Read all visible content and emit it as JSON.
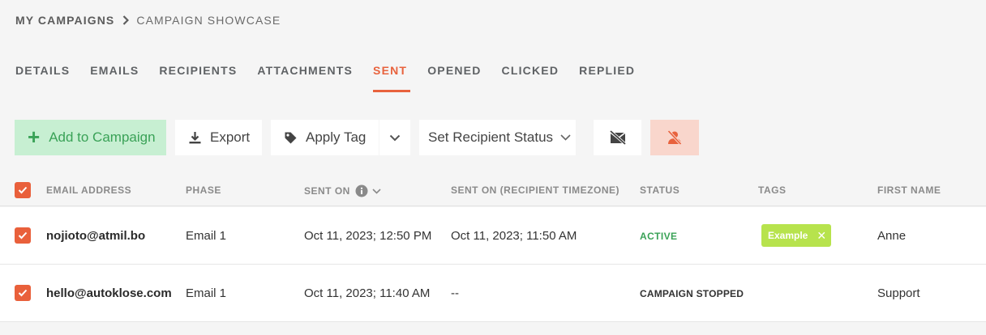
{
  "breadcrumb": {
    "root": "MY CAMPAIGNS",
    "current": "CAMPAIGN SHOWCASE"
  },
  "tabs": [
    {
      "label": "DETAILS",
      "active": false
    },
    {
      "label": "EMAILS",
      "active": false
    },
    {
      "label": "RECIPIENTS",
      "active": false
    },
    {
      "label": "ATTACHMENTS",
      "active": false
    },
    {
      "label": "SENT",
      "active": true
    },
    {
      "label": "OPENED",
      "active": false
    },
    {
      "label": "CLICKED",
      "active": false
    },
    {
      "label": "REPLIED",
      "active": false
    }
  ],
  "toolbar": {
    "add_label": "Add to Campaign",
    "export_label": "Export",
    "apply_tag_label": "Apply Tag",
    "set_status_label": "Set Recipient Status"
  },
  "table": {
    "headers": {
      "email": "EMAIL ADDRESS",
      "phase": "PHASE",
      "sent_on": "SENT ON",
      "sent_on_tz": "SENT ON (RECIPIENT TIMEZONE)",
      "status": "STATUS",
      "tags": "TAGS",
      "first_name": "FIRST NAME"
    },
    "rows": [
      {
        "email": "nojioto@atmil.bo",
        "phase": "Email 1",
        "sent_on": "Oct 11, 2023; 12:50 PM",
        "sent_on_tz": "Oct 11, 2023; 11:50 AM",
        "status": "ACTIVE",
        "tag": "Example",
        "first_name": "Anne"
      },
      {
        "email": "hello@autoklose.com",
        "phase": "Email 1",
        "sent_on": "Oct 11, 2023; 11:40 AM",
        "sent_on_tz": "--",
        "status": "CAMPAIGN STOPPED",
        "tag": "",
        "first_name": "Support"
      }
    ]
  },
  "colors": {
    "accent": "#e8623d",
    "success": "#3aa257",
    "tag": "#b7e34d"
  }
}
